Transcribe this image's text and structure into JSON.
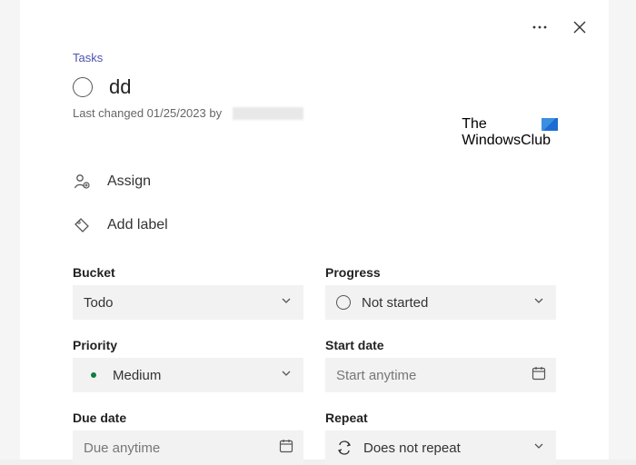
{
  "breadcrumb": "Tasks",
  "task": {
    "title": "dd",
    "meta_prefix": "Last changed 01/25/2023 by"
  },
  "watermark": {
    "line1": "The",
    "line2": "WindowsClub"
  },
  "actions": {
    "assign": "Assign",
    "add_label": "Add label"
  },
  "fields": {
    "bucket": {
      "label": "Bucket",
      "value": "Todo"
    },
    "progress": {
      "label": "Progress",
      "value": "Not started"
    },
    "priority": {
      "label": "Priority",
      "value": "Medium"
    },
    "start_date": {
      "label": "Start date",
      "placeholder": "Start anytime"
    },
    "due_date": {
      "label": "Due date",
      "placeholder": "Due anytime"
    },
    "repeat": {
      "label": "Repeat",
      "value": "Does not repeat"
    }
  }
}
